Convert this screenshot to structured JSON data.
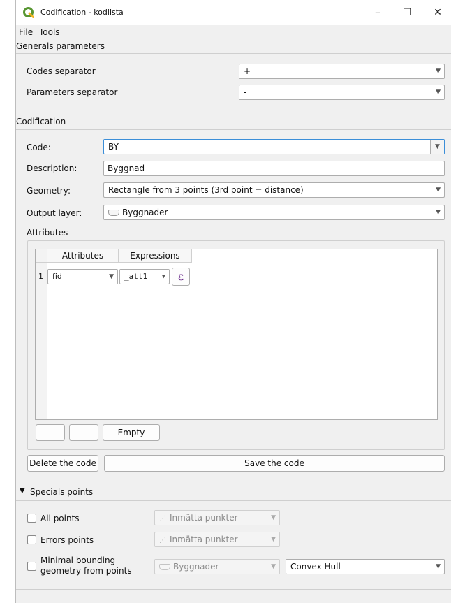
{
  "window": {
    "title": "Codification - kodlista",
    "minimize": "–",
    "maximize": "☐",
    "close": "✕"
  },
  "menu": {
    "file": "File",
    "tools": "Tools"
  },
  "generals": {
    "header": "Generals parameters",
    "codes_separator_label": "Codes separator",
    "codes_separator_value": "+",
    "params_separator_label": "Parameters separator",
    "params_separator_value": "-"
  },
  "codification": {
    "header": "Codification",
    "code_label": "Code:",
    "code_value": "BY",
    "description_label": "Description:",
    "description_value": "Byggnad",
    "geometry_label": "Geometry:",
    "geometry_value": "Rectangle from 3 points (3rd point = distance)",
    "output_layer_label": "Output layer:",
    "output_layer_value": "Byggnader",
    "attributes_header": "Attributes"
  },
  "attributes_table": {
    "columns": [
      "Attributes",
      "Expressions"
    ],
    "rows": [
      {
        "index": "1",
        "attribute": "fid",
        "expression": "_att1",
        "expr_button": "ε"
      }
    ],
    "empty_button": "Empty"
  },
  "actions": {
    "delete": "Delete the code",
    "save": "Save the code"
  },
  "specials": {
    "header": "Specials points",
    "all_points_label": "All points",
    "all_points_layer": "Inmätta punkter",
    "errors_points_label": "Errors points",
    "errors_points_layer": "Inmätta punkter",
    "minimal_label_line1": "Minimal bounding",
    "minimal_label_line2": "geometry from points",
    "minimal_layer": "Byggnader",
    "minimal_method": "Convex Hull"
  },
  "colors": {
    "accent": "#3b8ed8",
    "qgis_green": "#589632",
    "background": "#f0f0f0"
  },
  "icons": {
    "app": "qgis-logo-icon",
    "expression": "epsilon-icon",
    "collapse": "triangle-down-icon"
  }
}
